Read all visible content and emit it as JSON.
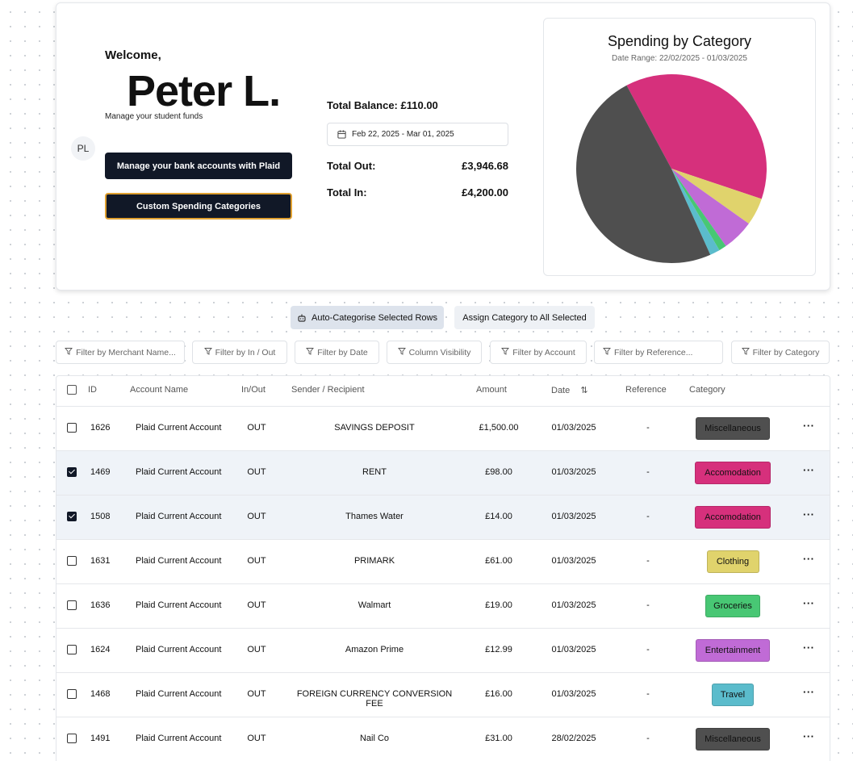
{
  "header": {
    "welcome": "Welcome,",
    "name": "Peter L.",
    "subtitle": "Manage your student funds",
    "avatar_initials": "PL",
    "plaid_button": "Manage your bank accounts with Plaid",
    "custom_categories_button": "Custom Spending Categories"
  },
  "summary": {
    "total_balance": "Total Balance: £110.00",
    "date_range": "Feb 22, 2025 - Mar 01, 2025",
    "total_out_label": "Total Out:",
    "total_out_value": "£3,946.68",
    "total_in_label": "Total In:",
    "total_in_value": "£4,200.00"
  },
  "chart_data": {
    "type": "pie",
    "title": "Spending by Category",
    "subtitle": "Date Range: 22/02/2025 - 01/03/2025",
    "legend": "none",
    "slices": [
      {
        "value": 38.0,
        "color": "#d6307c"
      },
      {
        "value": 4.7,
        "color": "#e0d36c"
      },
      {
        "value": 5.4,
        "color": "#c06bd6"
      },
      {
        "value": 1.3,
        "color": "#48c774"
      },
      {
        "value": 1.7,
        "color": "#5bbccc"
      },
      {
        "value": 48.9,
        "color": "#4f4f4f"
      }
    ]
  },
  "actions": {
    "auto_categorise": "Auto-Categorise Selected Rows",
    "assign_category": "Assign Category to All Selected"
  },
  "filters": {
    "merchant_placeholder": "Filter by Merchant Name...",
    "in_out": "Filter by In / Out",
    "date": "Filter by Date",
    "column_visibility": "Column Visibility",
    "account": "Filter by Account",
    "reference_placeholder": "Filter by Reference...",
    "category": "Filter by Category"
  },
  "table": {
    "columns": {
      "id": "ID",
      "account": "Account Name",
      "inout": "In/Out",
      "recipient": "Sender / Recipient",
      "amount": "Amount",
      "date": "Date",
      "reference": "Reference",
      "category": "Category"
    },
    "rows": [
      {
        "id": "1626",
        "account": "Plaid Current Account",
        "inout": "OUT",
        "recipient": "SAVINGS DEPOSIT",
        "amount": "£1,500.00",
        "date": "01/03/2025",
        "reference": "-",
        "category": "Miscellaneous",
        "category_color": "#4f4f4f",
        "checked": false
      },
      {
        "id": "1469",
        "account": "Plaid Current Account",
        "inout": "OUT",
        "recipient": "RENT",
        "amount": "£98.00",
        "date": "01/03/2025",
        "reference": "-",
        "category": "Accomodation",
        "category_color": "#d6307c",
        "checked": true
      },
      {
        "id": "1508",
        "account": "Plaid Current Account",
        "inout": "OUT",
        "recipient": "Thames Water",
        "amount": "£14.00",
        "date": "01/03/2025",
        "reference": "-",
        "category": "Accomodation",
        "category_color": "#d6307c",
        "checked": true
      },
      {
        "id": "1631",
        "account": "Plaid Current Account",
        "inout": "OUT",
        "recipient": "PRIMARK",
        "amount": "£61.00",
        "date": "01/03/2025",
        "reference": "-",
        "category": "Clothing",
        "category_color": "#e0d36c",
        "checked": false
      },
      {
        "id": "1636",
        "account": "Plaid Current Account",
        "inout": "OUT",
        "recipient": "Walmart",
        "amount": "£19.00",
        "date": "01/03/2025",
        "reference": "-",
        "category": "Groceries",
        "category_color": "#48c774",
        "checked": false
      },
      {
        "id": "1624",
        "account": "Plaid Current Account",
        "inout": "OUT",
        "recipient": "Amazon Prime",
        "amount": "£12.99",
        "date": "01/03/2025",
        "reference": "-",
        "category": "Entertainment",
        "category_color": "#c06bd6",
        "checked": false
      },
      {
        "id": "1468",
        "account": "Plaid Current Account",
        "inout": "OUT",
        "recipient": "FOREIGN CURRENCY CONVERSION FEE",
        "amount": "£16.00",
        "date": "01/03/2025",
        "reference": "-",
        "category": "Travel",
        "category_color": "#5bbccc",
        "checked": false
      },
      {
        "id": "1491",
        "account": "Plaid Current Account",
        "inout": "OUT",
        "recipient": "Nail Co",
        "amount": "£31.00",
        "date": "28/02/2025",
        "reference": "-",
        "category": "Miscellaneous",
        "category_color": "#4f4f4f",
        "checked": false
      }
    ]
  }
}
